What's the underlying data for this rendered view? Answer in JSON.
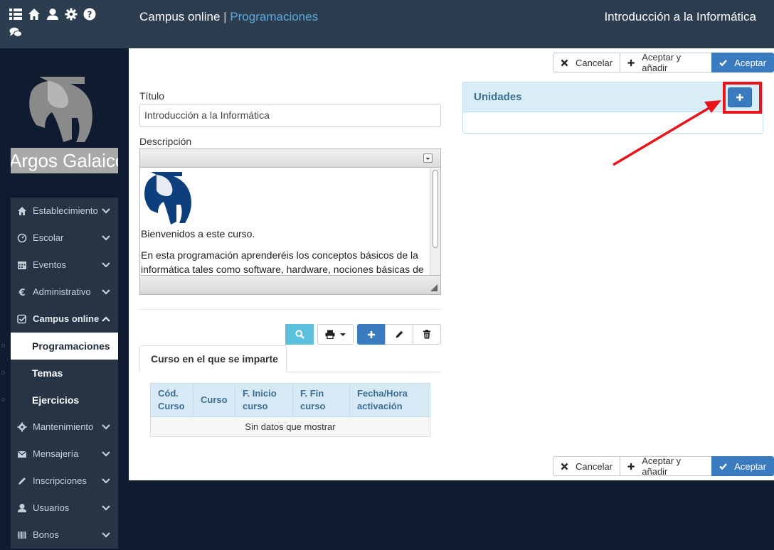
{
  "header": {
    "brand": "Campus online",
    "separator": "|",
    "section": "Programaciones",
    "right_title": "Introducción a la Informática",
    "icons": [
      "list-icon",
      "home-icon",
      "user-icon",
      "gear-icon",
      "help-icon",
      "chat-icon"
    ]
  },
  "sidebar": {
    "logo_text": "Argos Galaico",
    "items": [
      {
        "label": "Establecimiento",
        "icon": "home-icon"
      },
      {
        "label": "Escolar",
        "icon": "dashboard-icon"
      },
      {
        "label": "Eventos",
        "icon": "calendar-icon"
      },
      {
        "label": "Administrativo",
        "icon": "euro-icon"
      },
      {
        "label": "Campus online",
        "icon": "check-icon"
      },
      {
        "label": "Mantenimiento",
        "icon": "gear-icon"
      },
      {
        "label": "Mensajería",
        "icon": "mail-icon"
      },
      {
        "label": "Inscripciones",
        "icon": "pencil-icon"
      },
      {
        "label": "Usuarios",
        "icon": "user-icon"
      },
      {
        "label": "Bonos",
        "icon": "barcode-icon"
      }
    ],
    "subitems": [
      {
        "label": "Programaciones",
        "active": true
      },
      {
        "label": "Temas",
        "active": false
      },
      {
        "label": "Ejercicios",
        "active": false
      }
    ]
  },
  "actions": {
    "cancel": "Cancelar",
    "accept_add": "Aceptar y añadir",
    "accept": "Aceptar"
  },
  "form": {
    "title_label": "Título",
    "title_value": "Introducción a la Informática",
    "description_label": "Descripción",
    "description_p1": "Bienvenidos a este curso.",
    "description_p2": "En esta programación aprenderéis los conceptos básicos de la",
    "description_p3": "informática tales como software, hardware, nociones básicas de"
  },
  "courses": {
    "tab_label": "Curso en el que se imparte",
    "columns": [
      "Cód. Curso",
      "Curso",
      "F. Inicio curso",
      "F. Fin curso",
      "Fecha/Hora activación"
    ],
    "empty_text": "Sin datos que mostrar"
  },
  "units": {
    "title": "Unidades",
    "add_label": "+"
  },
  "colors": {
    "header_bg": "#2d3d50",
    "sidebar_bg": "#0f1c30",
    "primary": "#3a7bbf",
    "info": "#5bc0de",
    "panel_head": "#d9edf7",
    "highlight": "#e8141c"
  }
}
